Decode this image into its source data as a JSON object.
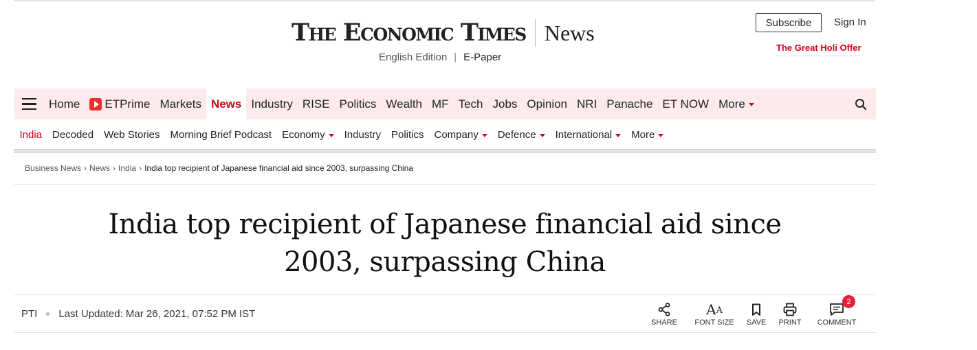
{
  "header": {
    "brand": "The Economic Times",
    "section": "News",
    "edition": "English Edition",
    "epaper": "E-Paper",
    "subscribe": "Subscribe",
    "signin": "Sign In",
    "promo": "The Great Holi Offer"
  },
  "nav": {
    "items": [
      "Home",
      "ETPrime",
      "Markets",
      "News",
      "Industry",
      "RISE",
      "Politics",
      "Wealth",
      "MF",
      "Tech",
      "Jobs",
      "Opinion",
      "NRI",
      "Panache",
      "ET NOW",
      "More"
    ],
    "active": "News"
  },
  "subnav": {
    "items": [
      "India",
      "Decoded",
      "Web Stories",
      "Morning Brief Podcast",
      "Economy",
      "Industry",
      "Politics",
      "Company",
      "Defence",
      "International",
      "More"
    ],
    "active": "India"
  },
  "breadcrumb": [
    "Business News",
    "News",
    "India",
    "India top recipient of Japanese financial aid since 2003, surpassing China"
  ],
  "article": {
    "headline_line1": "India top recipient of Japanese financial aid since",
    "headline_line2": "2003, surpassing China",
    "author": "PTI",
    "updated": "Last Updated: Mar 26, 2021, 07:52 PM IST"
  },
  "actions": {
    "share": "SHARE",
    "font_size": "FONT SIZE",
    "save": "SAVE",
    "print": "PRINT",
    "comment": "COMMENT",
    "comment_count": "2"
  },
  "colors": {
    "accent": "#d0021b",
    "nav_bg": "#fcebea"
  }
}
